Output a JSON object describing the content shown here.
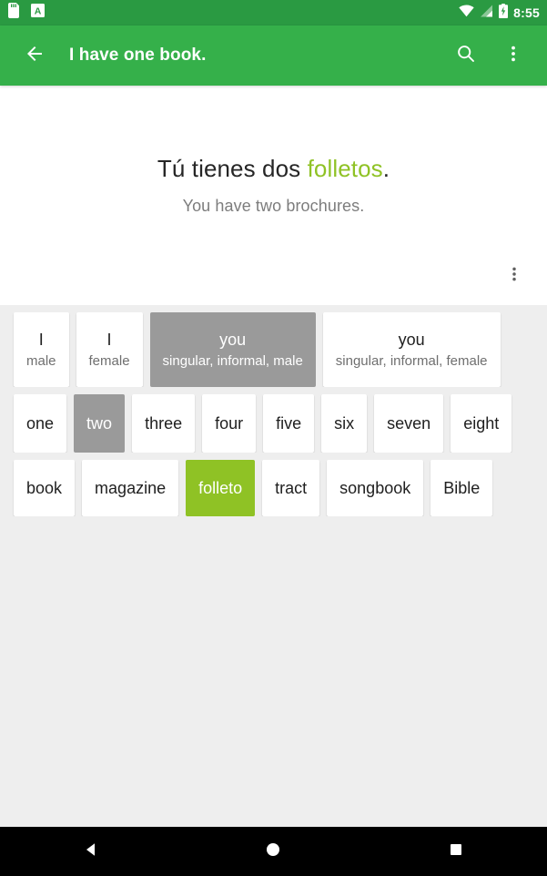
{
  "status_bar": {
    "icons": [
      "sd-card-icon",
      "app-notification-icon"
    ],
    "wifi_icon": "wifi-icon",
    "signal_icon": "cellular-signal-icon",
    "battery_icon": "battery-charging-icon",
    "time": "8:55"
  },
  "toolbar": {
    "back_icon": "back-arrow-icon",
    "title": "I have one book.",
    "search_icon": "search-icon",
    "overflow_icon": "overflow-menu-icon"
  },
  "sentence_card": {
    "target_prefix": "Tú tienes dos ",
    "target_highlight": "folletos",
    "target_suffix": ".",
    "translation": "You have two brochures.",
    "menu_icon": "overflow-menu-icon"
  },
  "chip_rows": [
    {
      "name": "pronoun-row",
      "chips": [
        {
          "main": "I",
          "sub": "male",
          "state": "default"
        },
        {
          "main": "I",
          "sub": "female",
          "state": "default"
        },
        {
          "main": "you",
          "sub": "singular, informal, male",
          "state": "selected"
        },
        {
          "main": "you",
          "sub": "singular, informal, female",
          "state": "default"
        }
      ]
    },
    {
      "name": "number-row",
      "chips": [
        {
          "main": "one",
          "sub": "",
          "state": "default"
        },
        {
          "main": "two",
          "sub": "",
          "state": "selected"
        },
        {
          "main": "three",
          "sub": "",
          "state": "default"
        },
        {
          "main": "four",
          "sub": "",
          "state": "default"
        },
        {
          "main": "five",
          "sub": "",
          "state": "default"
        },
        {
          "main": "six",
          "sub": "",
          "state": "default"
        },
        {
          "main": "seven",
          "sub": "",
          "state": "default"
        },
        {
          "main": "eight",
          "sub": "",
          "state": "default"
        }
      ]
    },
    {
      "name": "noun-row",
      "chips": [
        {
          "main": "book",
          "sub": "",
          "state": "default"
        },
        {
          "main": "magazine",
          "sub": "",
          "state": "default"
        },
        {
          "main": "folleto",
          "sub": "",
          "state": "accent"
        },
        {
          "main": "tract",
          "sub": "",
          "state": "default"
        },
        {
          "main": "songbook",
          "sub": "",
          "state": "default"
        },
        {
          "main": "Bible",
          "sub": "",
          "state": "default"
        }
      ]
    }
  ],
  "nav_bar": {
    "back_icon": "nav-back-triangle-icon",
    "home_icon": "nav-home-circle-icon",
    "recents_icon": "nav-recents-square-icon"
  },
  "colors": {
    "status_bar": "#2a9a42",
    "toolbar": "#35b04a",
    "accent_green": "#8fc225",
    "selected_gray": "#9a9a9a",
    "background": "#eeeeee",
    "card": "#ffffff"
  }
}
